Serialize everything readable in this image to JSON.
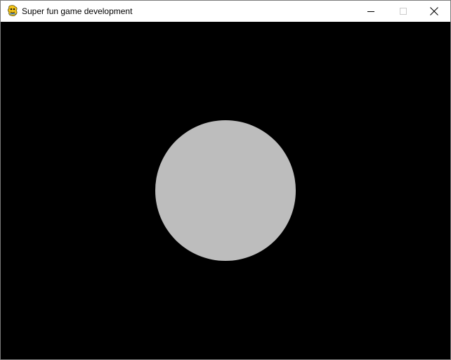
{
  "window": {
    "title": "Super fun game development",
    "icon": "pygame-snake-icon",
    "controls": {
      "minimize": "minimize-icon",
      "maximize": "maximize-icon",
      "close": "close-icon"
    }
  },
  "game": {
    "background_color": "#000000",
    "circle": {
      "shape": "circle",
      "color": "#bdbdbd"
    }
  }
}
